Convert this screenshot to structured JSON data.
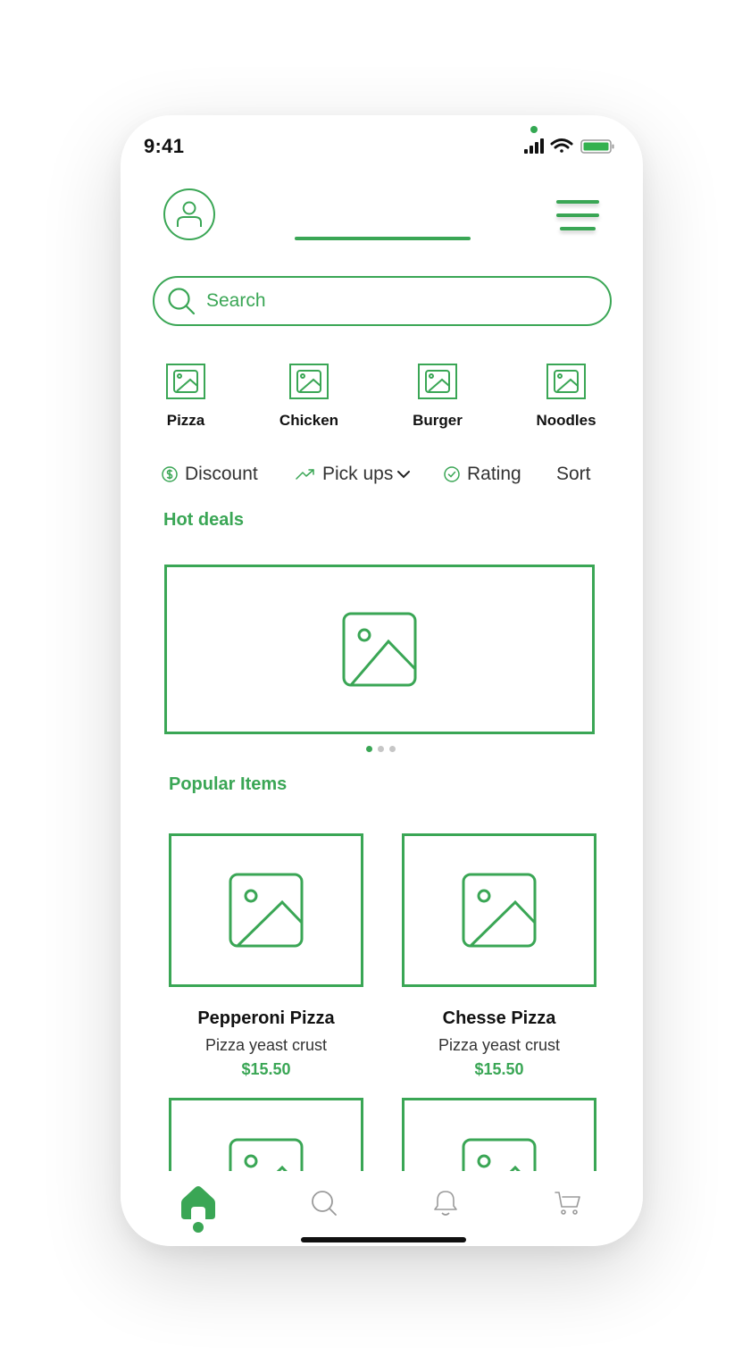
{
  "status_bar": {
    "time": "9:41"
  },
  "search": {
    "placeholder": "Search"
  },
  "categories": [
    {
      "label": "Pizza"
    },
    {
      "label": "Chicken"
    },
    {
      "label": "Burger"
    },
    {
      "label": "Noodles"
    }
  ],
  "filters": {
    "discount": "Discount",
    "pickups": "Pick ups",
    "rating": "Rating",
    "sort": "Sort"
  },
  "hot_deals": {
    "title": "Hot deals",
    "carousel_pages": 3,
    "active_page": 1
  },
  "popular": {
    "title": "Popular Items",
    "items": [
      {
        "name": "Pepperoni Pizza",
        "desc": "Pizza yeast crust",
        "price": "$15.50"
      },
      {
        "name": "Chesse Pizza",
        "desc": "Pizza yeast crust",
        "price": "$15.50"
      }
    ]
  },
  "bottom_nav": {
    "items": [
      {
        "icon": "home-icon",
        "active": true
      },
      {
        "icon": "search-icon",
        "active": false
      },
      {
        "icon": "bell-icon",
        "active": false
      },
      {
        "icon": "cart-icon",
        "active": false
      }
    ]
  },
  "colors": {
    "accent": "#3aa655",
    "text": "#111111",
    "inactive": "#9a9a9a"
  }
}
